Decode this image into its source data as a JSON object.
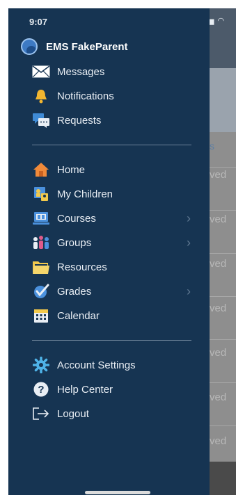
{
  "status_bar": {
    "time": "9:07"
  },
  "drawer": {
    "user_name": "EMS FakeParent",
    "top_items": [
      {
        "label": "Messages",
        "icon": "envelope-icon"
      },
      {
        "label": "Notifications",
        "icon": "bell-icon"
      },
      {
        "label": "Requests",
        "icon": "chat-bubbles-icon"
      }
    ],
    "main_items": [
      {
        "label": "Home",
        "icon": "house-icon"
      },
      {
        "label": "My Children",
        "icon": "children-icon"
      },
      {
        "label": "Courses",
        "icon": "laptop-icon",
        "has_submenu": true
      },
      {
        "label": "Groups",
        "icon": "people-icon",
        "has_submenu": true
      },
      {
        "label": "Resources",
        "icon": "folder-icon"
      },
      {
        "label": "Grades",
        "icon": "checkmark-icon",
        "has_submenu": true
      },
      {
        "label": "Calendar",
        "icon": "calendar-icon"
      }
    ],
    "bottom_items": [
      {
        "label": "Account Settings",
        "icon": "gear-icon"
      },
      {
        "label": "Help Center",
        "icon": "help-icon"
      },
      {
        "label": "Logout",
        "icon": "logout-icon"
      }
    ]
  },
  "background": {
    "link_fragment": "s",
    "row_fragment": "ved"
  },
  "colors": {
    "drawer_bg": "#163452",
    "divider": "#6d8399",
    "text": "#e9eef4"
  }
}
